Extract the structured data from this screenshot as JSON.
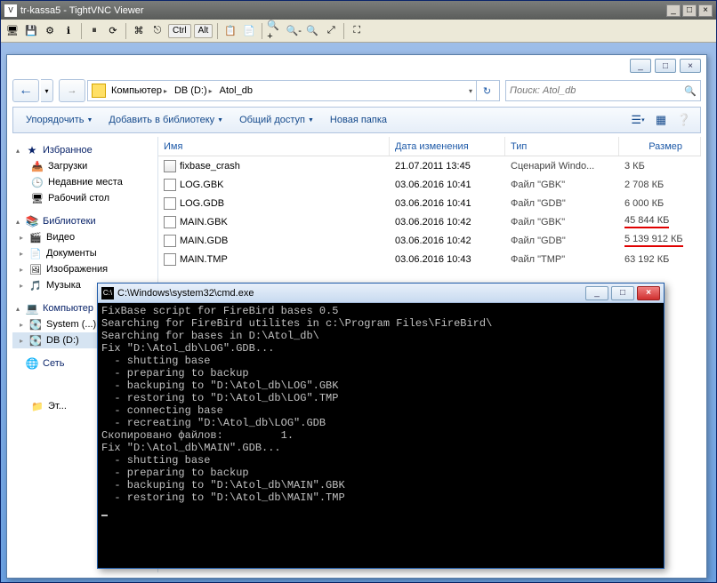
{
  "vnc": {
    "title": "tr-kassa5 - TightVNC Viewer",
    "toolbar_text": {
      "ctrl": "Ctrl",
      "alt": "Alt"
    }
  },
  "explorer": {
    "breadcrumb": [
      "Компьютер",
      "DB (D:)",
      "Atol_db"
    ],
    "search_placeholder": "Поиск: Atol_db",
    "menu": {
      "organize": "Упорядочить",
      "add_library": "Добавить в библиотеку",
      "share": "Общий доступ",
      "new_folder": "Новая папка"
    },
    "tree": {
      "favorites": "Избранное",
      "fav_items": [
        "Загрузки",
        "Недавние места",
        "Рабочий стол"
      ],
      "libraries": "Библиотеки",
      "lib_items": [
        "Видео",
        "Документы",
        "Изображения",
        "Музыка"
      ],
      "computer": "Компьютер",
      "comp_items": [
        "System (...)",
        "DB (D:)"
      ],
      "network": "Сеть",
      "etc": "Эт..."
    },
    "columns": {
      "name": "Имя",
      "date": "Дата изменения",
      "type": "Тип",
      "size": "Размер"
    },
    "files": [
      {
        "name": "fixbase_crash",
        "date": "21.07.2011 13:45",
        "type": "Сценарий Windo...",
        "size": "3 КБ",
        "icon": "script",
        "hl": false
      },
      {
        "name": "LOG.GBK",
        "date": "03.06.2016 10:41",
        "type": "Файл \"GBK\"",
        "size": "2 708 КБ",
        "icon": "file",
        "hl": false
      },
      {
        "name": "LOG.GDB",
        "date": "03.06.2016 10:41",
        "type": "Файл \"GDB\"",
        "size": "6 000 КБ",
        "icon": "file",
        "hl": false
      },
      {
        "name": "MAIN.GBK",
        "date": "03.06.2016 10:42",
        "type": "Файл \"GBK\"",
        "size": "45 844 КБ",
        "icon": "file",
        "hl": true
      },
      {
        "name": "MAIN.GDB",
        "date": "03.06.2016 10:42",
        "type": "Файл \"GDB\"",
        "size": "5 139 912 КБ",
        "icon": "file",
        "hl": true
      },
      {
        "name": "MAIN.TMP",
        "date": "03.06.2016 10:43",
        "type": "Файл \"TMP\"",
        "size": "63 192 КБ",
        "icon": "file",
        "hl": false
      }
    ]
  },
  "cmd": {
    "title": "C:\\Windows\\system32\\cmd.exe",
    "lines": [
      "FixBase script for FireBird bases 0.5",
      "Searching for FireBird utilites in c:\\Program Files\\FireBird\\",
      "Searching for bases in D:\\Atol_db\\",
      "Fix \"D:\\Atol_db\\LOG\".GDB...",
      "  - shutting base",
      "  - preparing to backup",
      "  - backuping to \"D:\\Atol_db\\LOG\".GBK",
      "  - restoring to \"D:\\Atol_db\\LOG\".TMP",
      "  - connecting base",
      "  - recreating \"D:\\Atol_db\\LOG\".GDB",
      "Скопировано файлов:         1.",
      "Fix \"D:\\Atol_db\\MAIN\".GDB...",
      "  - shutting base",
      "  - preparing to backup",
      "  - backuping to \"D:\\Atol_db\\MAIN\".GBK",
      "  - restoring to \"D:\\Atol_db\\MAIN\".TMP"
    ]
  }
}
